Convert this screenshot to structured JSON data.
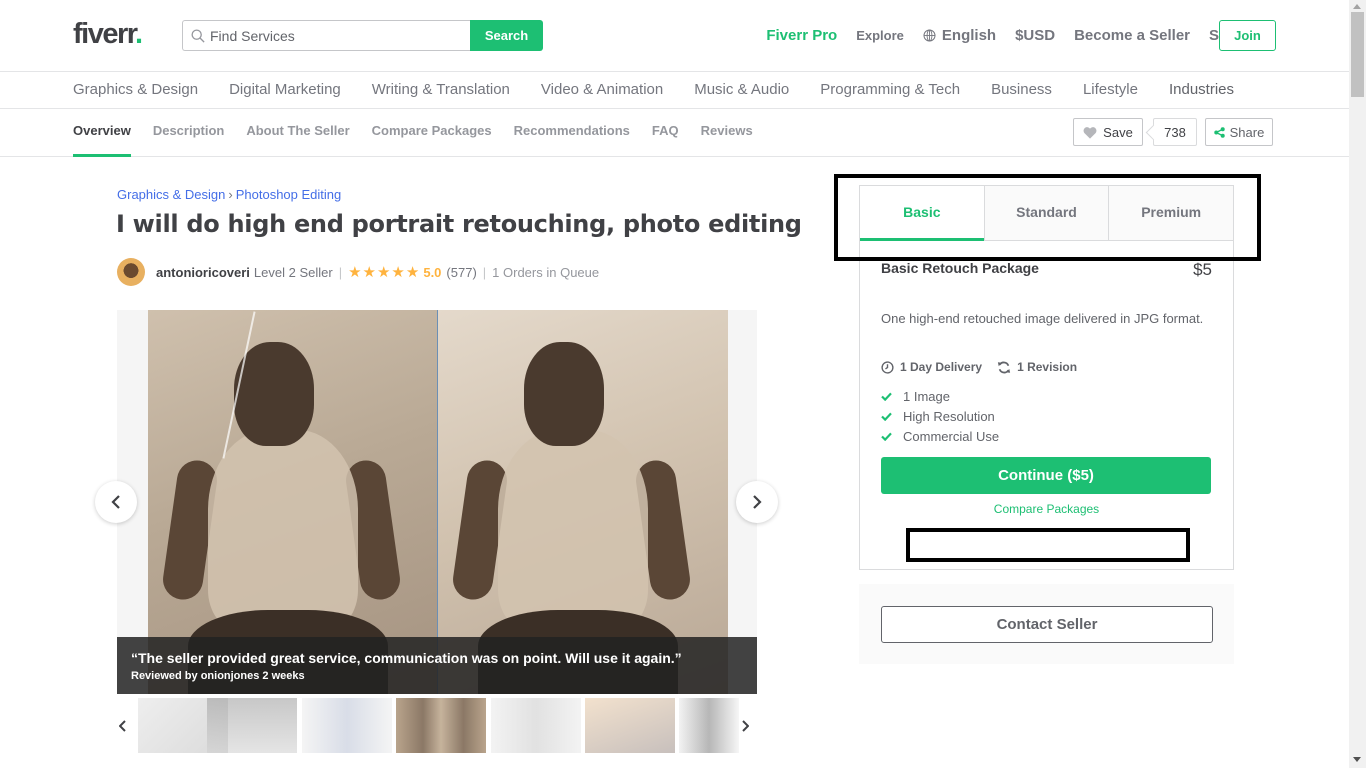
{
  "header": {
    "logo": "fiverr",
    "logo_dot": ".",
    "search_placeholder": "Find Services",
    "search_button": "Search",
    "nav": {
      "fiverr_pro": "Fiverr Pro",
      "explore": "Explore",
      "language": "English",
      "currency": "$USD",
      "become_seller": "Become a Seller",
      "sign_in": "Sign In",
      "join": "Join"
    }
  },
  "categories": [
    "Graphics & Design",
    "Digital Marketing",
    "Writing & Translation",
    "Video & Animation",
    "Music & Audio",
    "Programming & Tech",
    "Business",
    "Lifestyle",
    "Industries"
  ],
  "subnav": {
    "items": [
      "Overview",
      "Description",
      "About The Seller",
      "Compare Packages",
      "Recommendations",
      "FAQ",
      "Reviews"
    ],
    "active": "Overview",
    "save_label": "Save",
    "save_count": "738",
    "share_label": "Share"
  },
  "gig": {
    "breadcrumb": [
      "Graphics & Design",
      "Photoshop Editing"
    ],
    "breadcrumb_sep": "›",
    "title": "I will do high end portrait retouching, photo editing",
    "seller_name": "antonioricoveri",
    "seller_level": "Level 2 Seller",
    "stars": "★★★★★",
    "rating": "5.0",
    "review_count": "(577)",
    "queue": "1 Orders in Queue",
    "separator": "|"
  },
  "gallery": {
    "review_quote": "“The seller provided great service, communication was on point. Will use it again.”",
    "reviewed_by": "Reviewed by onionjones 2 weeks",
    "thumbnail_count": 7,
    "active_thumbnail": 4
  },
  "package": {
    "tabs": [
      "Basic",
      "Standard",
      "Premium"
    ],
    "active_tab": "Basic",
    "name": "Basic Retouch Package",
    "price": "$5",
    "description": "One high-end retouched image delivered in JPG format.",
    "delivery": "1 Day Delivery",
    "revisions": "1 Revision",
    "features": [
      "1 Image",
      "High Resolution",
      "Commercial Use"
    ],
    "continue_label": "Continue ($5)",
    "compare_label": "Compare Packages"
  },
  "contact": {
    "label": "Contact Seller"
  },
  "colors": {
    "brand_green": "#1dbf73",
    "star_yellow": "#ffb33e",
    "link_blue": "#446ee7"
  }
}
